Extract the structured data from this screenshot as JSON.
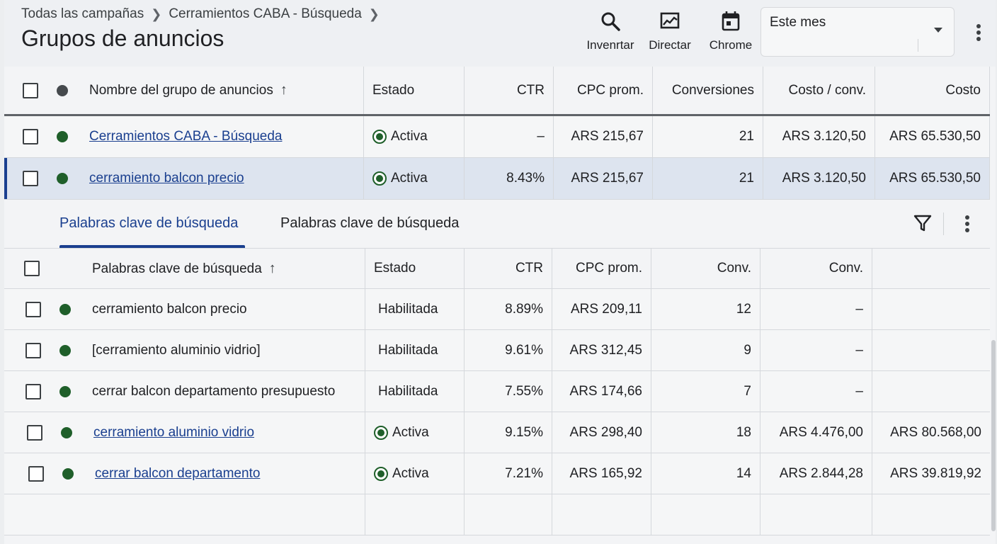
{
  "breadcrumb": [
    "Todas las campañas",
    "Cerramientos CABA - Búsqueda"
  ],
  "page_title": "Grupos de anuncios",
  "toolbar": {
    "search_label": "Invenrtar",
    "reports_label": "Directar",
    "calendar_label": "Chrome",
    "date_range": "Este mes"
  },
  "adgroups": {
    "columns": [
      "Nombre del grupo de anuncios",
      "Estado",
      "CTR",
      "CPC prom.",
      "Conversiones",
      "Costo / conv.",
      "Costo"
    ],
    "rows": [
      {
        "name": "Cerramientos CABA - Búsqueda",
        "status": "Activa",
        "ctr": "–",
        "cpc": "ARS 215,67",
        "conv": "21",
        "cost_conv": "ARS 3.120,50",
        "cost": "ARS 65.530,50"
      },
      {
        "name": "cerramiento balcon precio",
        "status": "Activa",
        "ctr": "8.43%",
        "cpc": "ARS 215,67",
        "conv": "21",
        "cost_conv": "ARS 3.120,50",
        "cost": "ARS 65.530,50"
      }
    ]
  },
  "tabs": [
    "Palabras clave de búsqueda",
    "Palabras clave de búsqueda"
  ],
  "keywords": {
    "columns": [
      "Palabras clave de búsqueda",
      "Estado",
      "CTR",
      "CPC prom.",
      "Conv.",
      "Conv.",
      ""
    ],
    "rows": [
      {
        "keyword": "cerramiento balcon precio",
        "status": "Habilitada",
        "ctr": "8.89%",
        "cpc": "ARS 209,11",
        "conv": "12",
        "conv2": "–",
        "extra": ""
      },
      {
        "keyword": "[cerramiento aluminio vidrio]",
        "status": "Habilitada",
        "ctr": "9.61%",
        "cpc": "ARS 312,45",
        "conv": "9",
        "conv2": "–",
        "extra": ""
      },
      {
        "keyword": "cerrar balcon departamento presupuesto",
        "status": "Habilitada",
        "ctr": "7.55%",
        "cpc": "ARS 174,66",
        "conv": "7",
        "conv2": "–",
        "extra": ""
      },
      {
        "keyword": "cerramiento aluminio vidrio",
        "status": "Activa",
        "ctr": "9.15%",
        "cpc": "ARS 298,40",
        "conv": "18",
        "conv2": "ARS 4.476,00",
        "extra": "ARS 80.568,00"
      },
      {
        "keyword": "cerrar balcon departamento",
        "status": "Activa",
        "ctr": "7.21%",
        "cpc": "ARS 165,92",
        "conv": "14",
        "conv2": "ARS 2.844,28",
        "extra": "ARS 39.819,92"
      }
    ]
  },
  "colors": {
    "accent": "#1a3f8f",
    "status_green": "#1f5f2a",
    "selected_row": "#dde4ef"
  },
  "icons": [
    "search-icon",
    "reports-icon",
    "calendar-icon",
    "more-vert-icon",
    "filter-icon",
    "sort-arrow-up-icon"
  ]
}
